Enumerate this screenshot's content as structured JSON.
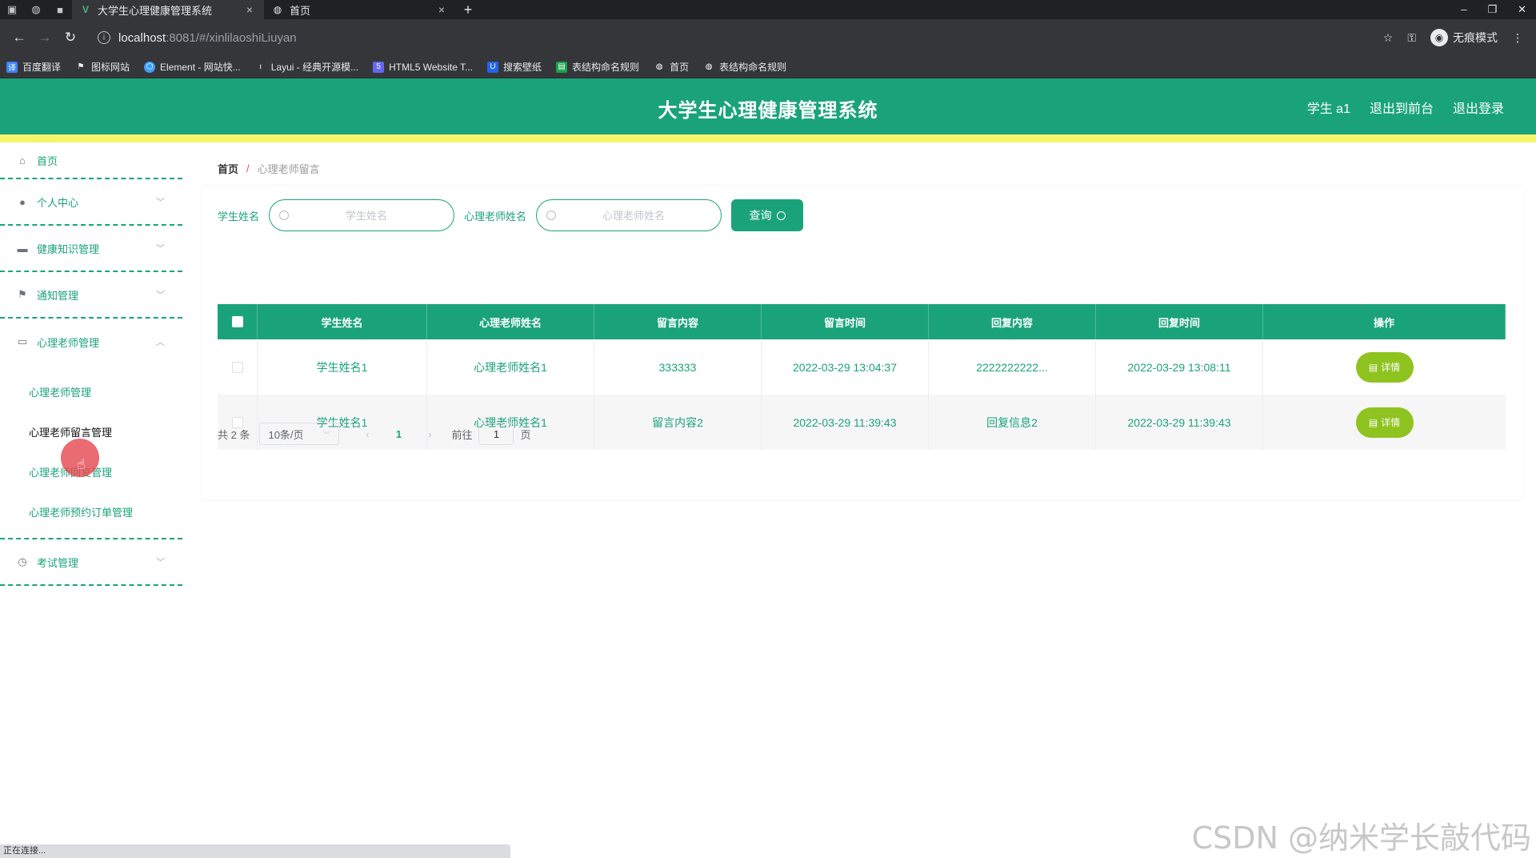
{
  "browser": {
    "tabs": [
      {
        "title": "大学生心理健康管理系统",
        "active": true
      },
      {
        "title": "首页",
        "active": false
      }
    ],
    "url_host": "localhost",
    "url_path": ":8081/#/xinlilaoshiLiuyan",
    "incognito_label": "无痕模式",
    "bookmarks": [
      "百度翻译",
      "图标网站",
      "Element - 网站快...",
      "Layui - 经典开源模...",
      "HTML5 Website T...",
      "搜索壁纸",
      "表结构命名规则",
      "首页",
      "表结构命名规则"
    ],
    "status_text": "正在连接..."
  },
  "header": {
    "title": "大学生心理健康管理系统",
    "user": "学生 a1",
    "back_front": "退出到前台",
    "logout": "退出登录"
  },
  "sidebar": {
    "items": [
      {
        "label": "首页",
        "icon": "home-icon"
      },
      {
        "label": "个人中心",
        "icon": "user-icon"
      },
      {
        "label": "健康知识管理",
        "icon": "briefcase-icon"
      },
      {
        "label": "通知管理",
        "icon": "flag-icon"
      },
      {
        "label": "心理老师管理",
        "icon": "chat-icon"
      },
      {
        "label": "考试管理",
        "icon": "clock-icon"
      }
    ],
    "sub_items": [
      "心理老师管理",
      "心理老师留言管理",
      "心理老师回复管理",
      "心理老师预约订单管理"
    ]
  },
  "breadcrumb": {
    "home": "首页",
    "separator": "/",
    "current": "心理老师留言"
  },
  "search": {
    "student_label": "学生姓名",
    "student_placeholder": "学生姓名",
    "teacher_label": "心理老师姓名",
    "teacher_placeholder": "心理老师姓名",
    "query_button": "查询"
  },
  "table": {
    "headers": [
      "学生姓名",
      "心理老师姓名",
      "留言内容",
      "留言时间",
      "回复内容",
      "回复时间",
      "操作"
    ],
    "rows": [
      [
        "学生姓名1",
        "心理老师姓名1",
        "333333",
        "2022-03-29 13:04:37",
        "2222222222...",
        "2022-03-29 13:08:11"
      ],
      [
        "学生姓名1",
        "心理老师姓名1",
        "留言内容2",
        "2022-03-29 11:39:43",
        "回复信息2",
        "2022-03-29 11:39:43"
      ]
    ],
    "detail_button": "详情"
  },
  "pagination": {
    "total": "共 2 条",
    "page_size": "10条/页",
    "current_page": "1",
    "goto_label": "前往",
    "goto_value": "1",
    "page_suffix": "页"
  },
  "watermark": "CSDN @纳米学长敲代码",
  "colors": {
    "primary": "#1aa37a",
    "accent_bar": "#f5f56a",
    "detail_button": "#8fc31f"
  }
}
